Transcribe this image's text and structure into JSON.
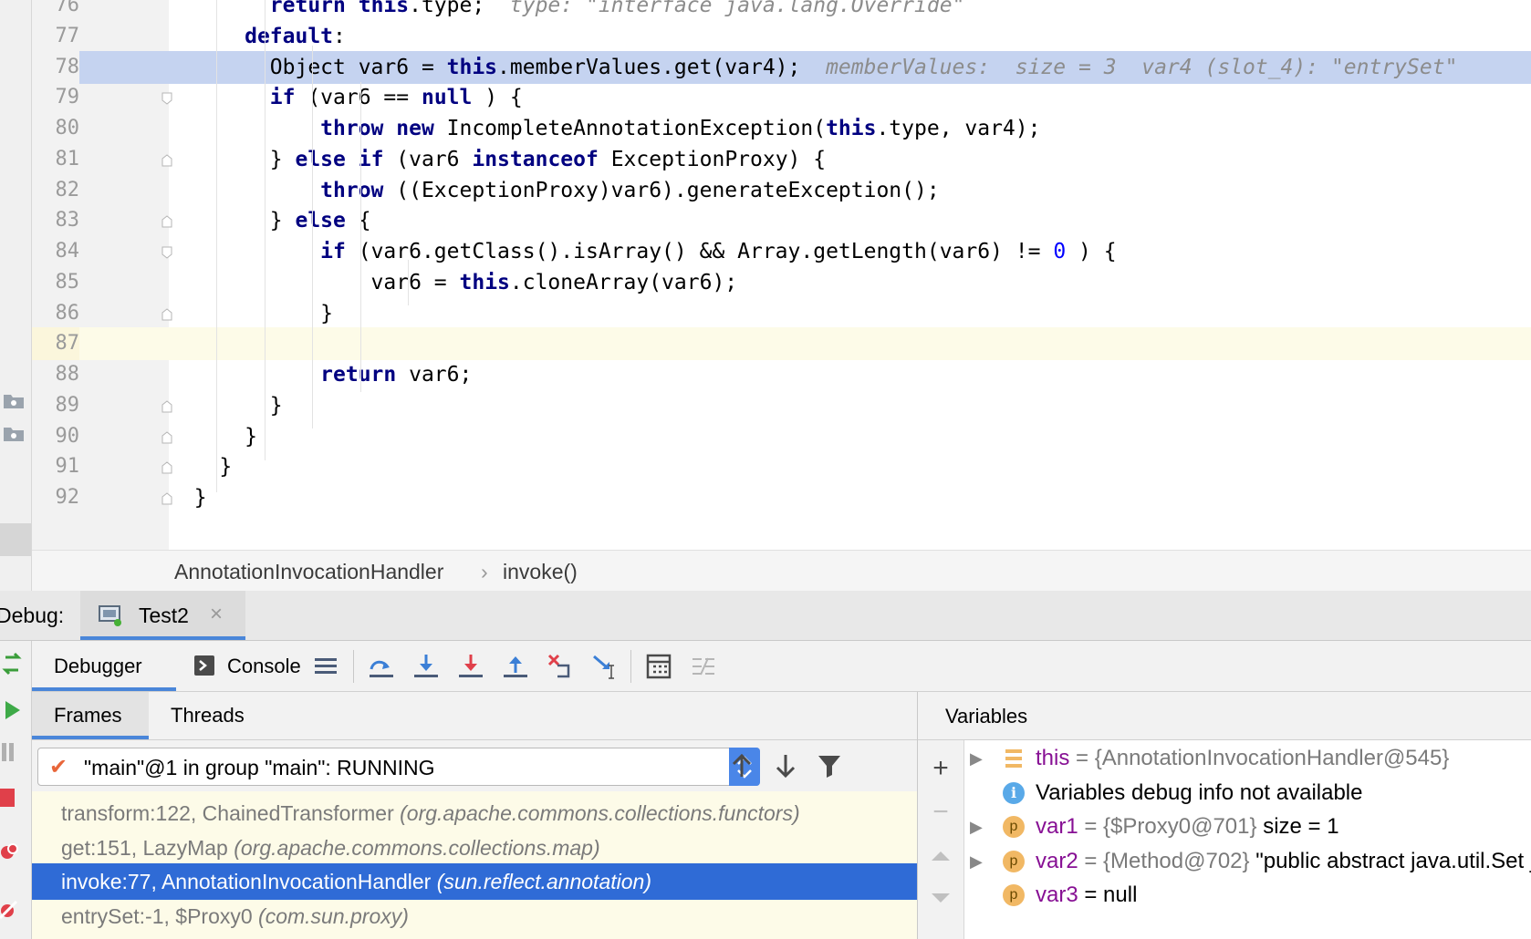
{
  "editor": {
    "lines": [
      {
        "num": "76",
        "tokens": [
          [
            "",
            "        "
          ],
          [
            "kw",
            "return "
          ],
          [
            "kw",
            "this"
          ],
          [
            "",
            ".type;  "
          ],
          [
            "hint",
            "type: \"interface java.lang.Override\""
          ]
        ]
      },
      {
        "num": "77",
        "tokens": [
          [
            "",
            "      "
          ],
          [
            "kw",
            "default"
          ],
          [
            "",
            ":"
          ]
        ]
      },
      {
        "num": "78",
        "tokens": [
          [
            "",
            "        Object var6 = "
          ],
          [
            "kw",
            "this"
          ],
          [
            "",
            ".memberValues.get(var4);  "
          ],
          [
            "hint",
            "memberValues:  size = 3  var4 (slot_4): \"entrySet\""
          ]
        ]
      },
      {
        "num": "79",
        "tokens": [
          [
            "",
            "        "
          ],
          [
            "kw",
            "if"
          ],
          [
            "",
            " (var6 == "
          ],
          [
            "kw",
            "null"
          ],
          [
            "",
            " ) {"
          ]
        ]
      },
      {
        "num": "80",
        "tokens": [
          [
            "",
            "            "
          ],
          [
            "kw",
            "throw new"
          ],
          [
            "",
            " IncompleteAnnotationException("
          ],
          [
            "kw",
            "this"
          ],
          [
            "",
            ".type, var4);"
          ]
        ]
      },
      {
        "num": "81",
        "tokens": [
          [
            "",
            "        } "
          ],
          [
            "kw",
            "else if"
          ],
          [
            "",
            " (var6 "
          ],
          [
            "kw",
            "instanceof"
          ],
          [
            "",
            " ExceptionProxy) {"
          ]
        ]
      },
      {
        "num": "82",
        "tokens": [
          [
            "",
            "            "
          ],
          [
            "kw",
            "throw"
          ],
          [
            "",
            " ((ExceptionProxy)var6).generateException();"
          ]
        ]
      },
      {
        "num": "83",
        "tokens": [
          [
            "",
            "        } "
          ],
          [
            "kw",
            "else"
          ],
          [
            "",
            " {"
          ]
        ]
      },
      {
        "num": "84",
        "tokens": [
          [
            "",
            "            "
          ],
          [
            "kw",
            "if"
          ],
          [
            "",
            " (var6.getClass().isArray() && Array.getLength(var6) != "
          ],
          [
            "num",
            "0"
          ],
          [
            "",
            " ) {"
          ]
        ]
      },
      {
        "num": "85",
        "tokens": [
          [
            "",
            "                var6 = "
          ],
          [
            "kw",
            "this"
          ],
          [
            "",
            ".cloneArray(var6);"
          ]
        ]
      },
      {
        "num": "86",
        "tokens": [
          [
            "",
            "            }"
          ]
        ]
      },
      {
        "num": "87",
        "tokens": []
      },
      {
        "num": "88",
        "tokens": [
          [
            "",
            "            "
          ],
          [
            "kw",
            "return"
          ],
          [
            "",
            " var6;"
          ]
        ]
      },
      {
        "num": "89",
        "tokens": [
          [
            "",
            "        }"
          ]
        ]
      },
      {
        "num": "90",
        "tokens": [
          [
            "",
            "      }"
          ]
        ]
      },
      {
        "num": "91",
        "tokens": [
          [
            "",
            "    }"
          ]
        ]
      },
      {
        "num": "92",
        "tokens": [
          [
            "",
            "  }"
          ]
        ]
      }
    ],
    "exec_line": "78",
    "cursor_line": "87"
  },
  "breadcrumb": {
    "class_name": "AnnotationInvocationHandler",
    "separator": "›",
    "method": "invoke()"
  },
  "debug": {
    "label": "Debug:",
    "session_tab": "Test2",
    "tabs": {
      "debugger": "Debugger",
      "console": "Console"
    },
    "frames_tabs": {
      "frames": "Frames",
      "threads": "Threads"
    },
    "thread_selector": "\"main\"@1 in group \"main\": RUNNING",
    "frames": [
      {
        "method": "transform:122, ChainedTransformer ",
        "pkg": "(org.apache.commons.collections.functors)",
        "selected": false
      },
      {
        "method": "get:151, LazyMap ",
        "pkg": "(org.apache.commons.collections.map)",
        "selected": false
      },
      {
        "method": "invoke:77, AnnotationInvocationHandler ",
        "pkg": "(sun.reflect.annotation)",
        "selected": true
      },
      {
        "method": "entrySet:-1, $Proxy0 ",
        "pkg": "(com.sun.proxy)",
        "selected": false
      }
    ],
    "variables_title": "Variables",
    "variables": [
      {
        "icon": "field",
        "expandable": true,
        "name": "this",
        "value": " = {AnnotationInvocationHandler@545}",
        "extra": ""
      },
      {
        "icon": "info",
        "expandable": false,
        "name": "",
        "value": "Variables debug info not available",
        "extra": ""
      },
      {
        "icon": "p",
        "expandable": true,
        "name": "var1",
        "value": " = {$Proxy0@701}",
        "extra": "  size = 1"
      },
      {
        "icon": "p",
        "expandable": true,
        "name": "var2",
        "value": " = {Method@702}",
        "extra": " \"public abstract java.util.Set java.util.Map.entrySet()\""
      },
      {
        "icon": "p",
        "expandable": false,
        "name": "var3",
        "value": " = null",
        "extra": ""
      }
    ]
  },
  "colors": {
    "exec_highlight": "#c5d3f0",
    "selected_frame": "#2f6bd6",
    "keyword": "#000080"
  }
}
